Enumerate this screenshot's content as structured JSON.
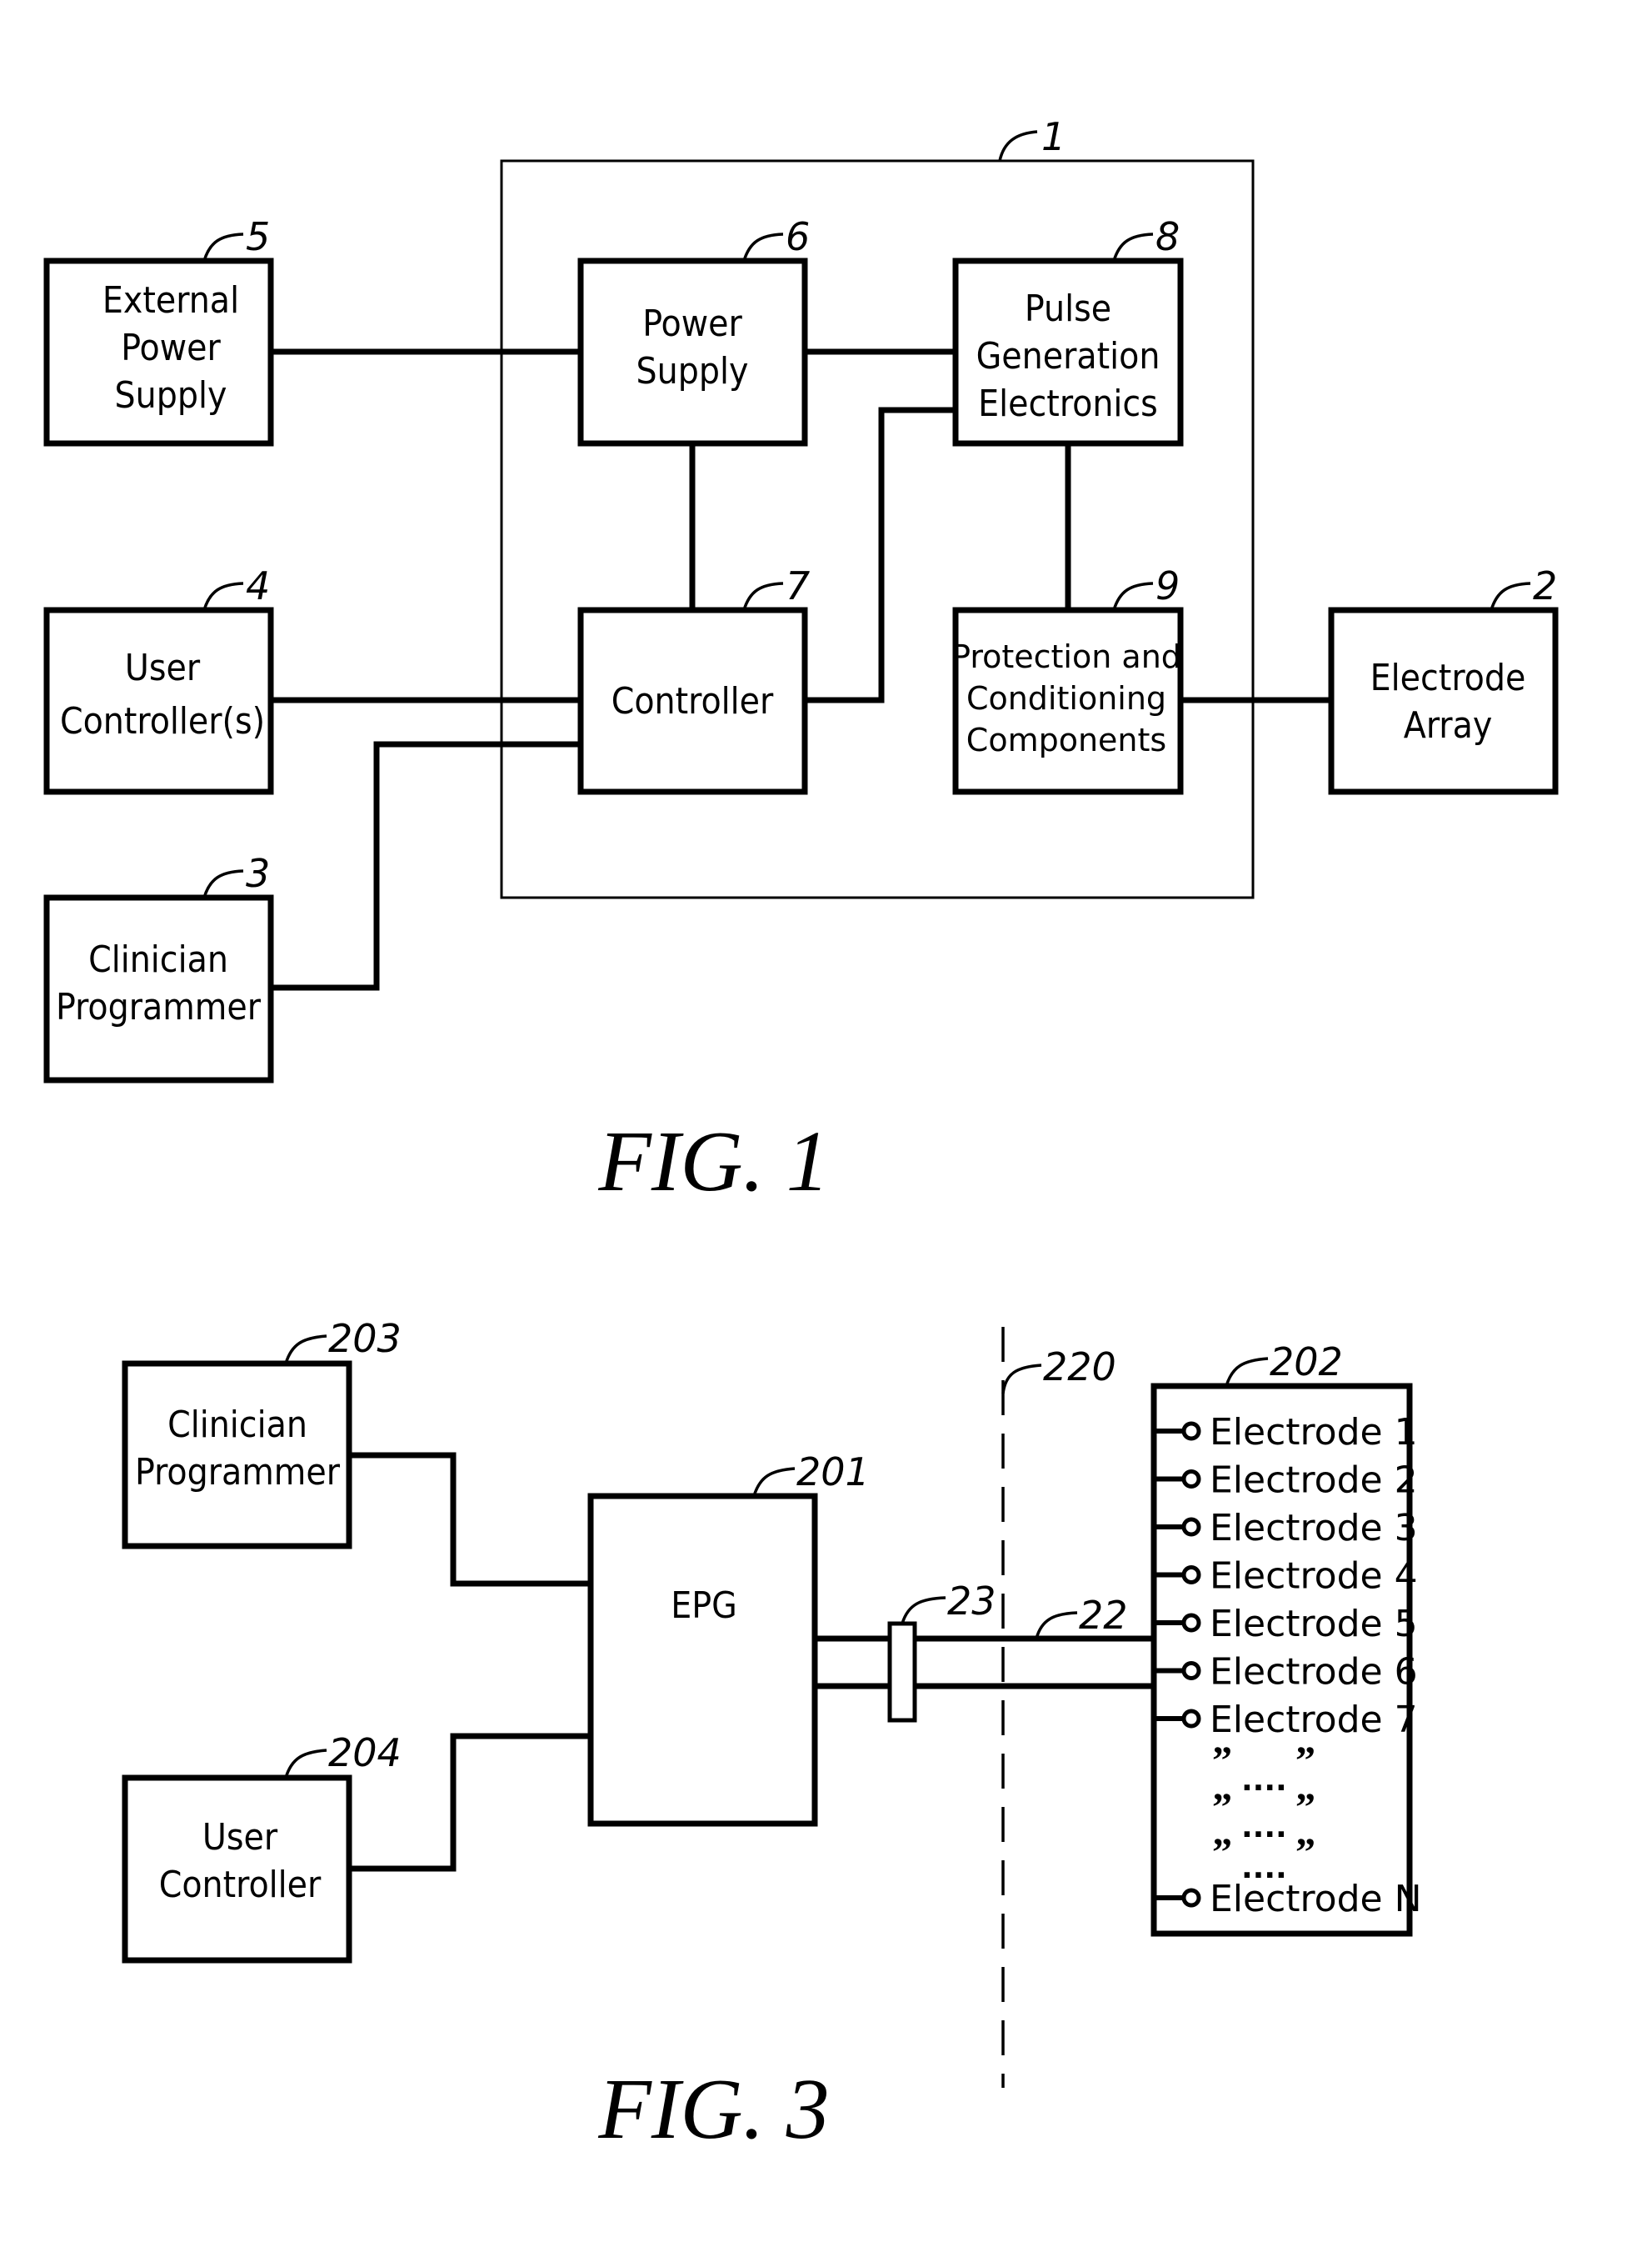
{
  "fig1": {
    "caption": "FIG. 1",
    "system": {
      "ref": "1"
    },
    "blocks": {
      "external_power_supply": {
        "ref": "5",
        "lines": [
          "External",
          "Power",
          "Supply"
        ]
      },
      "power_supply": {
        "ref": "6",
        "lines": [
          "Power",
          "Supply"
        ]
      },
      "pulse_generation": {
        "ref": "8",
        "lines": [
          "Pulse",
          "Generation",
          "Electronics"
        ]
      },
      "user_controllers": {
        "ref": "4",
        "lines": [
          "User",
          "Controller(s)"
        ]
      },
      "controller": {
        "ref": "7",
        "lines": [
          "Controller"
        ]
      },
      "protection": {
        "ref": "9",
        "lines": [
          "Protection  and",
          "Conditioning",
          "Components"
        ]
      },
      "electrode_array": {
        "ref": "2",
        "lines": [
          "Electrode",
          "Array"
        ]
      },
      "clinician_programmer": {
        "ref": "3",
        "lines": [
          "Clinician",
          "Programmer"
        ]
      }
    }
  },
  "fig3": {
    "caption": "FIG. 3",
    "boundary": {
      "ref": "220"
    },
    "lead": {
      "ref": "22"
    },
    "connector": {
      "ref": "23"
    },
    "blocks": {
      "clinician_programmer": {
        "ref": "203",
        "lines": [
          "Clinician",
          "Programmer"
        ]
      },
      "epg": {
        "ref": "201",
        "lines": [
          "EPG"
        ]
      },
      "user_controller": {
        "ref": "204",
        "lines": [
          "User",
          "Controller"
        ]
      },
      "electrodes": {
        "ref": "202",
        "items": [
          "Electrode  1",
          "Electrode  2",
          "Electrode  3",
          "Electrode  4",
          "Electrode  5",
          "Electrode  6",
          "Electrode  7"
        ],
        "ditto_mark": "”",
        "ellipsis": "....",
        "last": "Electrode  N"
      }
    }
  }
}
